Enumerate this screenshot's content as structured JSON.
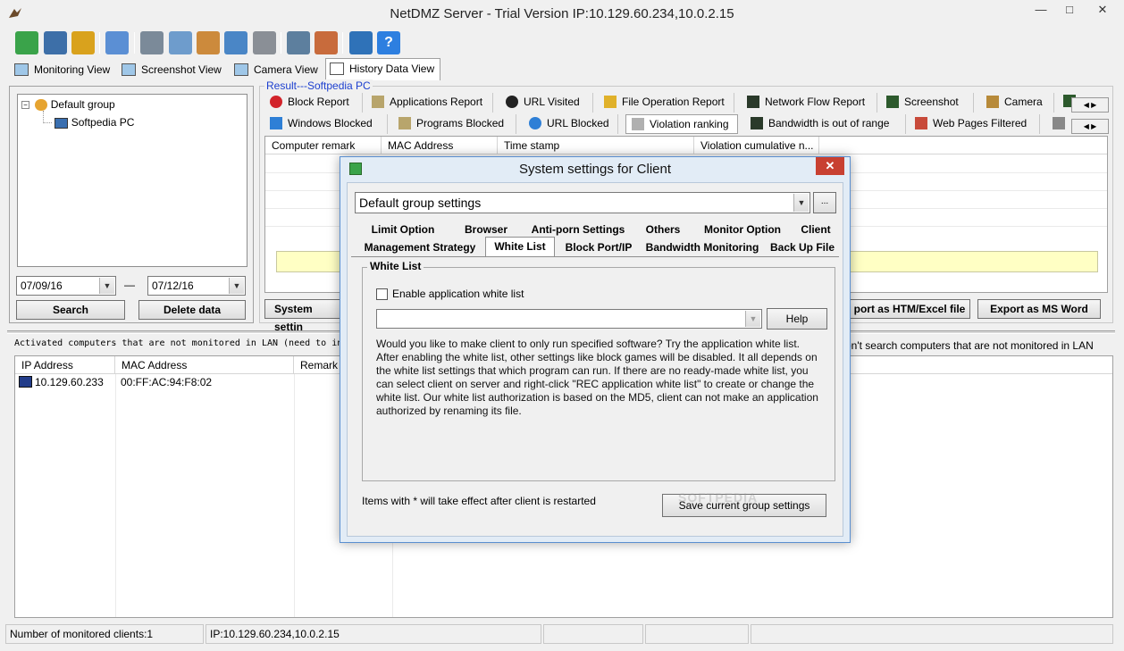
{
  "window": {
    "title": "NetDMZ Server - Trial Version IP:10.129.60.234,10.0.2.15",
    "min": "—",
    "max": "□",
    "close": "✕"
  },
  "toolbar": {
    "icons": [
      "group-icon",
      "settings-icon",
      "users-icon",
      "info-icon",
      "monitor-icon",
      "mail-icon",
      "report-icon",
      "network-icon",
      "disk-icon",
      "server-icon",
      "user-config-icon",
      "cart-icon",
      "help-icon"
    ]
  },
  "view_tabs": [
    "Monitoring View",
    "Screenshot View",
    "Camera View",
    "History Data View"
  ],
  "tree": {
    "root": "Default group",
    "child": "Softpedia PC",
    "root_expander": "−"
  },
  "date_from": "07/09/16",
  "date_sep": "—",
  "date_to": "07/12/16",
  "search_label": "Search",
  "delete_label": "Delete data",
  "result_label": "Result---Softpedia PC",
  "report_tabs_row1": [
    "Block Report",
    "Applications Report",
    "URL Visited",
    "File Operation Report",
    "Network Flow Report",
    "Screenshot",
    "Camera"
  ],
  "report_tabs_row2": [
    "Windows Blocked",
    "Programs Blocked",
    "URL Blocked",
    "Violation ranking",
    "Bandwidth is out of range",
    "Web Pages Filtered"
  ],
  "result_columns": [
    "Computer remark",
    "MAC Address",
    "Time stamp",
    "Violation cumulative n..."
  ],
  "system_settings_label": "System settin",
  "export_htm_label": "port as HTM/Excel file",
  "export_word_label": "Export as MS Word",
  "lan_notice_left": "Activated computers that are not monitored in LAN (need to in",
  "lan_notice_right": "on't search computers that are not monitored in LAN",
  "lan_columns": [
    "IP Address",
    "MAC Address",
    "Remark"
  ],
  "lan_rows": [
    {
      "ip": "10.129.60.233",
      "mac": "00:FF:AC:94:F8:02"
    }
  ],
  "dialog": {
    "title": "System settings for Client",
    "close": "✕",
    "group_select": "Default group settings",
    "more_label": "...",
    "tabs_row1": [
      "Limit Option",
      "Browser",
      "Anti-porn Settings",
      "Others",
      "Monitor Option",
      "Client"
    ],
    "tabs_row2": [
      "Management Strategy",
      "White List",
      "Block Port/IP",
      "Bandwidth Monitoring",
      "Back Up File"
    ],
    "white_list_group": "White List",
    "enable_label": "Enable application white list",
    "enable_checked": false,
    "help_label": "Help",
    "description": "Would you like to make client to only run specified software? Try the application white list. After enabling the white list, other settings like block games will be disabled. It all depends on the white list settings that which program can run. If there are no ready-made white list, you can select client on server and right-click \"REC application white list\" to create or change the white list. Our white list authorization is based on the MD5, client can not make an application authorized by renaming its file.",
    "restart_note": "Items with * will take effect after client is restarted",
    "save_label": "Save current group settings"
  },
  "status": {
    "clients": "Number of monitored clients:1",
    "ip": "IP:10.129.60.234,10.0.2.15"
  },
  "watermark": "SOFTPEDIA"
}
